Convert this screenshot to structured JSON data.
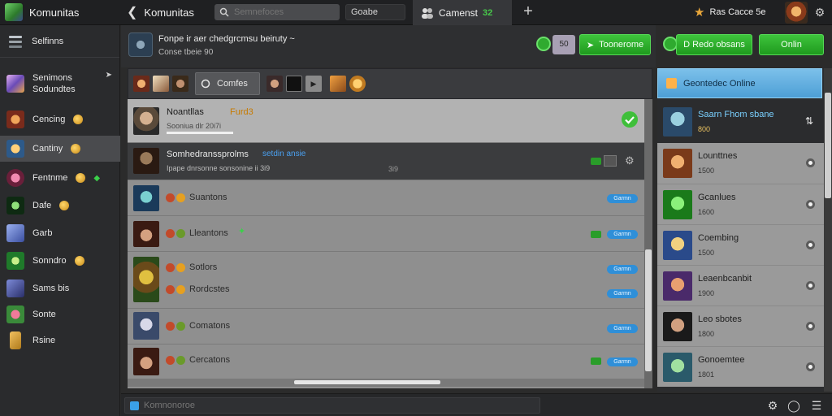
{
  "topbar": {
    "app_name": "Komunitas",
    "back_label": "Komunitas",
    "search_placeholder": "Semnefoces",
    "search_button": "Goabe",
    "tab_label": "Camenst",
    "tab_count": "32",
    "profile_name": "Ras Cacce 5e"
  },
  "sidebar": {
    "header_label": "Selfinns",
    "items": [
      {
        "label": "Senimons",
        "label2": "Sodundtes"
      },
      {
        "label": "Cencing"
      },
      {
        "label": "Cantiny"
      },
      {
        "label": "Fentnme"
      },
      {
        "label": "Dafe"
      },
      {
        "label": "Garb"
      },
      {
        "label": "Sonndro"
      },
      {
        "label": "Sams bis"
      },
      {
        "label": "Sonte"
      },
      {
        "label": "Rsine"
      }
    ]
  },
  "chat_header": {
    "title": "Fonpe ir aer chedgrcmsu beiruty ~",
    "subtitle": "Conse tbeie 90",
    "mini_icon": "50",
    "btn_primary": "Toonerome",
    "btn_secondary": "D Redo obsans",
    "btn_online": "Onlin"
  },
  "filter": {
    "pill_label": "Comfes"
  },
  "chat_rows": [
    {
      "name": "Noantllas",
      "extra": "Furd3",
      "sub": "Sooniua dlr 20i7i"
    },
    {
      "name": "Somhedranssprolms",
      "extra": "setdin ansie",
      "sub": "Ipape dnrsonne sonsonine ii 3i9",
      "time": "3i9"
    },
    {
      "name": "Suantons",
      "tag": "Garmn"
    },
    {
      "name": "Lleantons",
      "tag": "Garmn"
    },
    {
      "name": "Sotlors",
      "tag": "Garmn"
    },
    {
      "name": "Rordcstes",
      "tag": "Garmn"
    },
    {
      "name": "Comatons",
      "tag": "Garmn"
    },
    {
      "name": "Cercatons",
      "tag": "Garmn"
    }
  ],
  "bottom": {
    "compose_placeholder": "Komnonoroe"
  },
  "right_panel": {
    "header": "Geontedec Online",
    "rows": [
      {
        "title": "Saarn Fhom sbane",
        "sub": "800"
      },
      {
        "title": "Lounttnes",
        "sub": "1500"
      },
      {
        "title": "Gcanlues",
        "sub": "1600"
      },
      {
        "title": "Coembing",
        "sub": "1500"
      },
      {
        "title": "Leaenbcanbit",
        "sub": "1900"
      },
      {
        "title": "Leo sbotes",
        "sub": "1800"
      },
      {
        "title": "Gonoemtee",
        "sub": "1801"
      }
    ]
  }
}
